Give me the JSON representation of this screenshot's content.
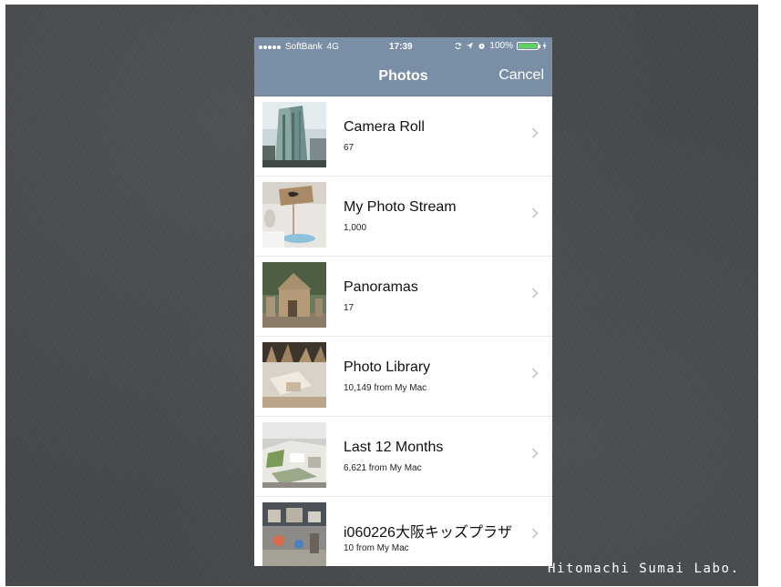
{
  "status_bar": {
    "carrier": "SoftBank",
    "network": "4G",
    "time": "17:39",
    "battery_percent": "100%",
    "battery_level": 1.0
  },
  "nav": {
    "title": "Photos",
    "cancel_label": "Cancel"
  },
  "albums": [
    {
      "name": "Camera Roll",
      "count": "67",
      "thumb": "building-photo"
    },
    {
      "name": "My Photo Stream",
      "count": "1,000",
      "thumb": "cardboard-sign-photo"
    },
    {
      "name": "Panoramas",
      "count": "17",
      "thumb": "cardboard-house-photo"
    },
    {
      "name": "Photo Library",
      "count": "10,149 from My Mac",
      "thumb": "cardboard-room-photo"
    },
    {
      "name": "Last 12 Months",
      "count": "6,621 from My Mac",
      "thumb": "model-terrain-photo"
    },
    {
      "name": "i060226大阪キッズプラザ",
      "count": "10 from My Mac",
      "thumb": "kids-plaza-photo"
    }
  ],
  "footer": {
    "caption": "Hitomachi Sumai Labo."
  },
  "colors": {
    "nav_background": "#7a8fa6",
    "slide_background": "#46494c",
    "battery_green": "#5fd35f"
  }
}
